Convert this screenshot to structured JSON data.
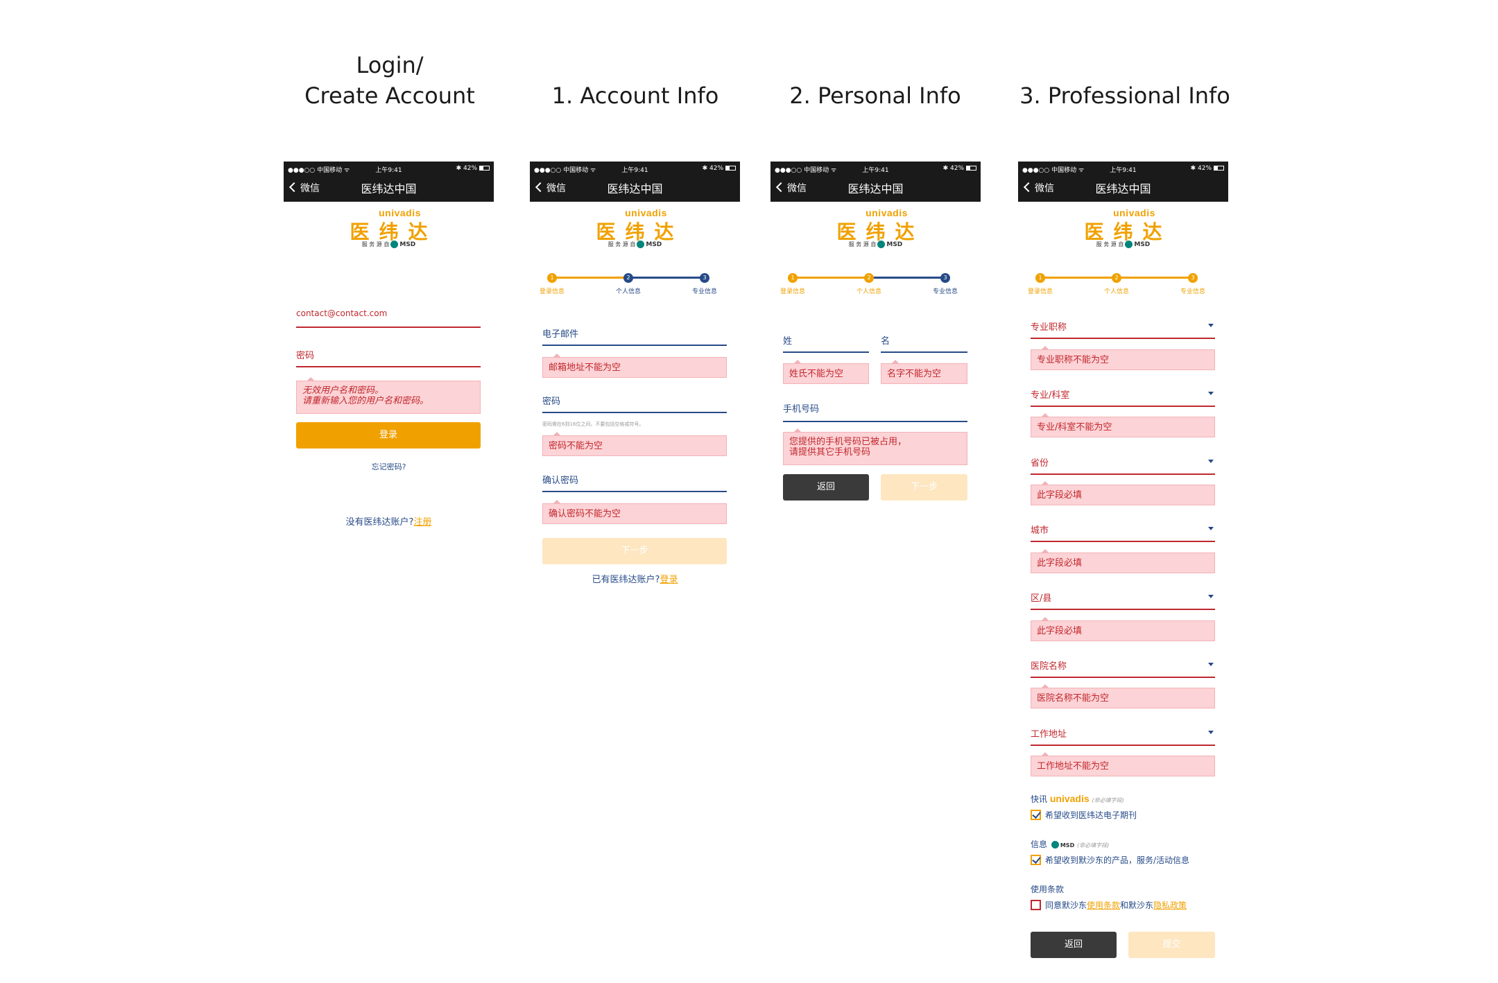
{
  "titles": {
    "login_line1": "Login/",
    "login_line2": "Create Account",
    "account": "1. Account Info",
    "personal": "2. Personal Info",
    "professional": "3. Professional Info"
  },
  "status": {
    "carrier": "●●●○○ 中国移动 ᯤ",
    "time": "上午9:41",
    "battery": "✱ 42%"
  },
  "nav": {
    "back": "微信",
    "title": "医纬达中国"
  },
  "logo": {
    "en": "univadis",
    "zh": "医纬达",
    "sub": "服 务 源 自",
    "msd": "MSD"
  },
  "steps": [
    "登录信息",
    "个人信息",
    "专业信息"
  ],
  "step_numbers": [
    "1",
    "2",
    "3"
  ],
  "colors": {
    "orange": "#f0a100",
    "navy": "#264a87",
    "red": "#c0272d",
    "error_bg": "#fcd3d6",
    "dark": "#3a3a3a",
    "pale": "#fde6c0"
  },
  "login": {
    "email": "contact@contact.com",
    "password": "密码",
    "error_line1": "无效用户名和密码。",
    "error_line2": "请重新输入您的用户名和密码。",
    "login_button": "登录",
    "forgot": "忘记密码?",
    "no_account": "没有医纬达账户?",
    "register": "注册"
  },
  "account": {
    "email_label": "电子邮件",
    "email_error": "邮箱地址不能为空",
    "password_label": "密码",
    "password_hint": "密码需在6到16位之间，不要包括空格或符号。",
    "password_error": "密码不能为空",
    "confirm_label": "确认密码",
    "confirm_error": "确认密码不能为空",
    "next_button": "下一步",
    "have_account": "已有医纬达账户?",
    "login_link": "登录"
  },
  "personal": {
    "last_label": "姓",
    "first_label": "名",
    "last_error": "姓氏不能为空",
    "first_error": "名字不能为空",
    "phone_label": "手机号码",
    "phone_error_line1": "您提供的手机号码已被占用，",
    "phone_error_line2": "请提供其它手机号码",
    "back_button": "返回",
    "next_button": "下一步"
  },
  "professional": {
    "fields": [
      {
        "label": "专业职称",
        "error": "专业职称不能为空"
      },
      {
        "label": "专业/科室",
        "error": "专业/科室不能为空"
      },
      {
        "label": "省份",
        "error": "此字段必填"
      },
      {
        "label": "城市",
        "error": "此字段必填"
      },
      {
        "label": "区/县",
        "error": "此字段必填"
      },
      {
        "label": "医院名称",
        "error": "医院名称不能为空"
      },
      {
        "label": "工作地址",
        "error": "工作地址不能为空"
      }
    ],
    "news_label": "快讯",
    "news_logo": "univadis",
    "optional": "(非必填字段)",
    "news_check": "希望收到医纬达电子期刊",
    "info_label": "信息",
    "info_logo": "MSD",
    "info_check": "希望收到默沙东的产品，服务/活动信息",
    "terms_label": "使用条款",
    "terms_pre": "同意默沙东",
    "terms_link1": "使用条款",
    "terms_mid": "和默沙东",
    "terms_link2": "隐私政策",
    "back_button": "返回",
    "submit_button": "提交"
  }
}
